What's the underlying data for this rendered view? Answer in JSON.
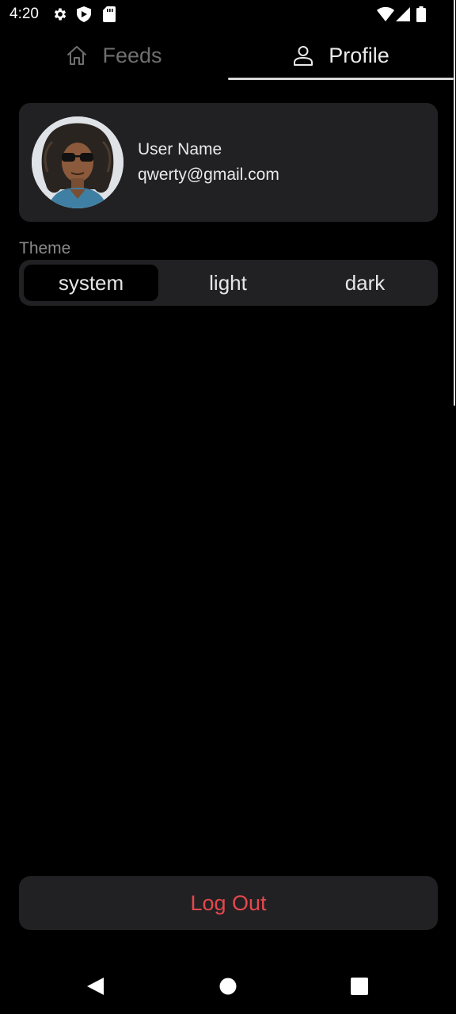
{
  "status_bar": {
    "time": "4:20",
    "left_icons": [
      "gear-icon",
      "shield-icon",
      "sd-card-icon"
    ],
    "right_icons": [
      "wifi-icon",
      "signal-icon",
      "battery-icon"
    ]
  },
  "tabs": [
    {
      "label": "Feeds",
      "icon": "home-icon",
      "selected": false
    },
    {
      "label": "Profile",
      "icon": "person-icon",
      "selected": true
    }
  ],
  "profile": {
    "name": "User Name",
    "email": "qwerty@gmail.com"
  },
  "theme": {
    "label": "Theme",
    "options": [
      "system",
      "light",
      "dark"
    ],
    "selected": "system"
  },
  "logout": {
    "label": "Log Out"
  },
  "colors": {
    "background": "#000000",
    "card": "#212123",
    "danger": "#e5484d",
    "tab_inactive": "#6f6f6f",
    "tab_active": "#eaeaea"
  },
  "nav_bar": [
    "back-icon",
    "home-circle-icon",
    "recents-icon"
  ]
}
